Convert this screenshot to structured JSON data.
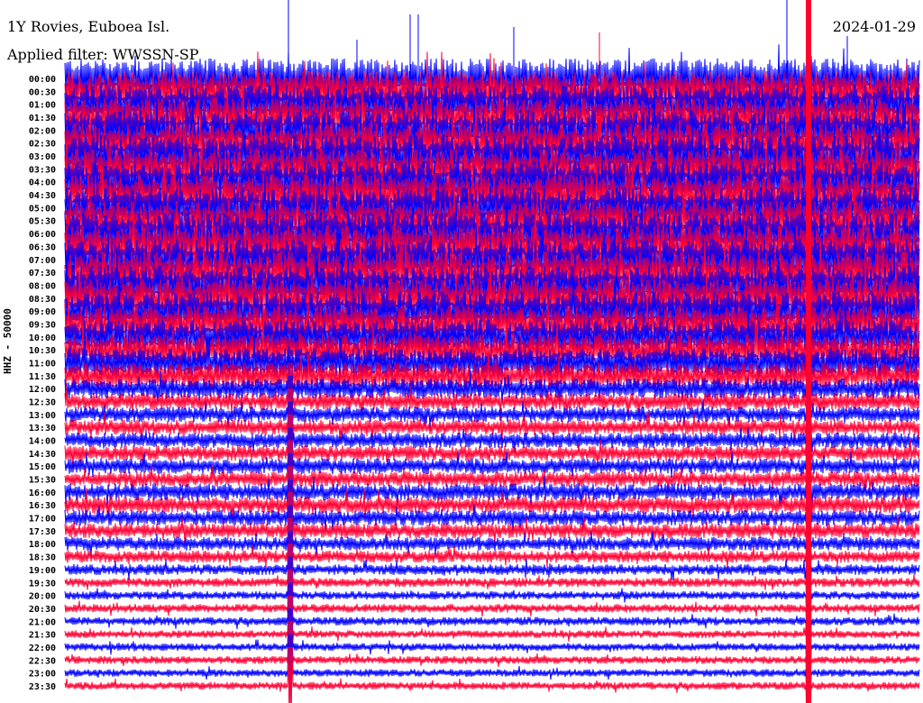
{
  "header": {
    "station": "1Y Rovies, Euboea Isl.",
    "filter": "Applied filter: WWSSN-SP",
    "date": "2024-01-29"
  },
  "chart_data": {
    "type": "line",
    "subtype": "helicorder",
    "title": "1Y Rovies, Euboea Isl.",
    "ylabel": "HHZ - 50000",
    "xlabel": "",
    "minutes_per_row": 30,
    "colors": {
      "even_rows": "#0000ff",
      "odd_rows": "#ff0033"
    },
    "row_labels": [
      "00:00",
      "00:30",
      "01:00",
      "01:30",
      "02:00",
      "02:30",
      "03:00",
      "03:30",
      "04:00",
      "04:30",
      "05:00",
      "05:30",
      "06:00",
      "06:30",
      "07:00",
      "07:30",
      "08:00",
      "08:30",
      "09:00",
      "09:30",
      "10:00",
      "10:30",
      "11:00",
      "11:30",
      "12:00",
      "12:30",
      "13:00",
      "13:30",
      "14:00",
      "14:30",
      "15:00",
      "15:30",
      "16:00",
      "16:30",
      "17:00",
      "17:30",
      "18:00",
      "18:30",
      "19:00",
      "19:30",
      "20:00",
      "20:30",
      "21:00",
      "21:30",
      "22:00",
      "22:30",
      "23:00",
      "23:30"
    ],
    "relative_amplitude": [
      2.6,
      2.6,
      2.5,
      2.5,
      2.6,
      2.6,
      2.7,
      2.7,
      2.7,
      2.7,
      2.6,
      2.6,
      2.8,
      2.8,
      2.7,
      2.7,
      2.6,
      2.6,
      2.5,
      2.4,
      2.2,
      2.1,
      1.9,
      1.7,
      1.3,
      1.1,
      1.0,
      1.0,
      1.0,
      1.0,
      1.0,
      1.0,
      1.1,
      1.1,
      1.0,
      1.0,
      0.9,
      0.8,
      0.7,
      0.6,
      0.55,
      0.55,
      0.55,
      0.5,
      0.5,
      0.5,
      0.5,
      0.5
    ],
    "events": [
      {
        "row": "00:00",
        "minute": 26.1,
        "amplitude": 6
      },
      {
        "row": "00:00",
        "minute": 7.9,
        "amplitude": 6
      }
    ]
  }
}
